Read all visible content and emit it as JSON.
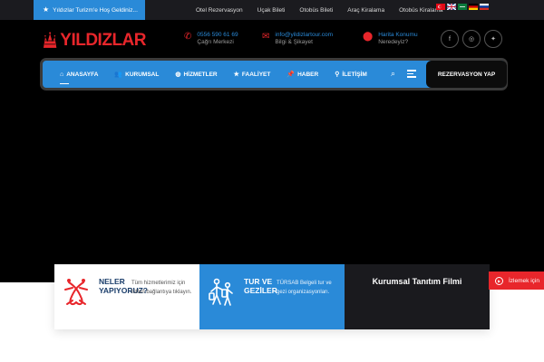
{
  "topbar": {
    "welcome": "Yıldızlar Turizm'e Hoş Geldiniz...",
    "links": [
      "Otel Rezervasyon",
      "Uçak Bileti",
      "Otobüs Bileti",
      "Araç Kiralama",
      "Otobüs Kiralama"
    ],
    "flags": [
      "turkish-flag",
      "english-flag",
      "arabic-flag",
      "german-flag",
      "russian-flag"
    ]
  },
  "brand": {
    "name": "YILDIZLAR",
    "color": "#e8262b"
  },
  "contacts": [
    {
      "icon": "phone-icon",
      "line1": "0556 590 61 69",
      "line2": "Çağrı Merkezi"
    },
    {
      "icon": "mail-icon",
      "line1": "info@yildizlartour.com",
      "line2": "Bilgi & Şikayet"
    },
    {
      "icon": "map-pin-icon",
      "line1": "Harita Konumu",
      "line2": "Neredeyiz?"
    }
  ],
  "social": [
    "facebook-icon",
    "instagram-icon",
    "twitter-icon"
  ],
  "nav": {
    "items": [
      {
        "label": "ANASAYFA",
        "icon": "home-icon"
      },
      {
        "label": "KURUMSAL",
        "icon": "users-icon"
      },
      {
        "label": "HİZMETLER",
        "icon": "globe-icon"
      },
      {
        "label": "FAALİYET",
        "icon": "star-icon"
      },
      {
        "label": "HABER",
        "icon": "pin-icon"
      },
      {
        "label": "İLETİŞİM",
        "icon": "location-icon"
      }
    ],
    "reserve": "REZERVASYON YAP"
  },
  "cards": {
    "services": {
      "title": "NELER YAPIYORUZ?",
      "desc": "Tüm hizmetlerimiz için lütfen bağlantıya tıklayın."
    },
    "tours": {
      "title": "TUR VE GEZİLER",
      "desc": "TÜRSAB Belgeli tur ve gezi organizasyonları."
    },
    "film": {
      "title": "Kurumsal Tanıtım Filmi"
    }
  },
  "watch": {
    "label": "İzlemek için"
  },
  "colors": {
    "accent": "#2a8ad8",
    "brand": "#e8262b",
    "dark": "#000000"
  }
}
